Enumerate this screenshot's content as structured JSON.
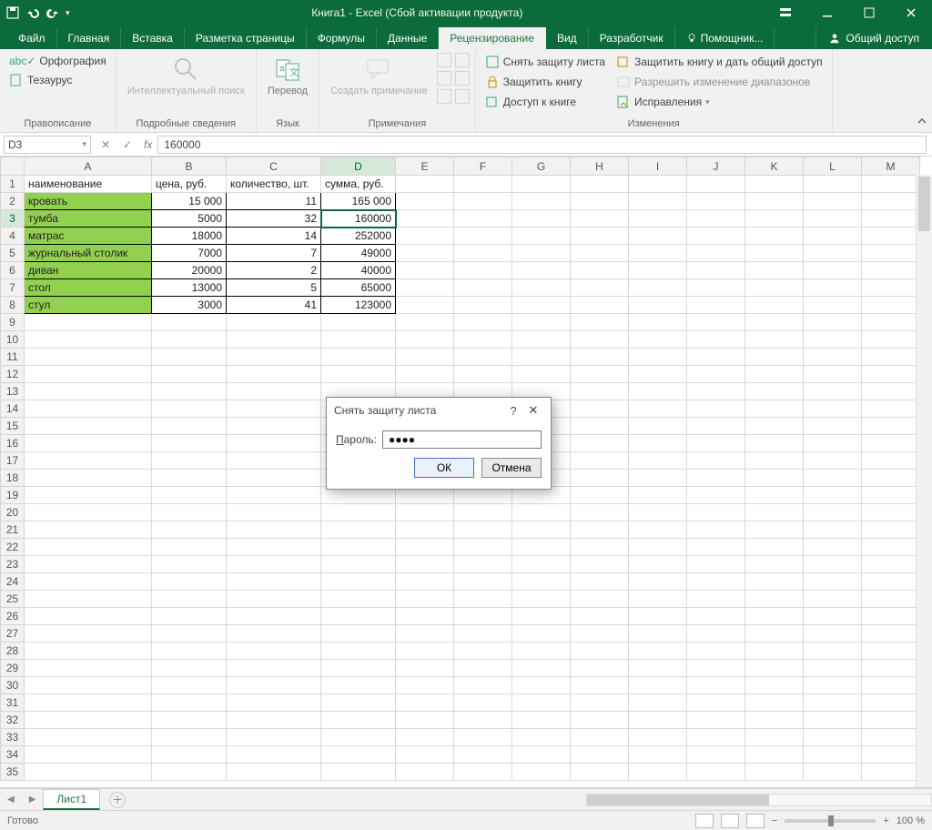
{
  "titlebar": {
    "title": "Книга1 - Excel (Сбой активации продукта)"
  },
  "tabs": {
    "file": "Файл",
    "home": "Главная",
    "insert": "Вставка",
    "layout": "Разметка страницы",
    "formulas": "Формулы",
    "data": "Данные",
    "review": "Рецензирование",
    "view": "Вид",
    "developer": "Разработчик",
    "help": "Помощник...",
    "share": "Общий доступ"
  },
  "ribbon": {
    "proof": {
      "spell": "Орфография",
      "thesaurus": "Тезаурус",
      "label": "Правописание"
    },
    "insights": {
      "smartlookup": "Интеллектуальный поиск",
      "label": "Подробные сведения"
    },
    "lang": {
      "translate": "Перевод",
      "label": "Язык"
    },
    "comments": {
      "new": "Создать примечание",
      "label": "Примечания"
    },
    "changes": {
      "unprotect_sheet": "Снять защиту листа",
      "protect_wb": "Защитить книгу",
      "share_wb": "Доступ к книге",
      "protect_share": "Защитить книгу и дать общий доступ",
      "allow_ranges": "Разрешить изменение диапазонов",
      "track": "Исправления",
      "label": "Изменения"
    }
  },
  "namebox": "D3",
  "formula_value": "160000",
  "columns": [
    "A",
    "B",
    "C",
    "D",
    "E",
    "F",
    "G",
    "H",
    "I",
    "J",
    "K",
    "L",
    "M"
  ],
  "col_widths": [
    "col-0",
    "col-1",
    "col-2",
    "col-3",
    "col-o",
    "col-o",
    "col-o",
    "col-o",
    "col-o",
    "col-o",
    "col-o",
    "col-o",
    "col-o"
  ],
  "headers": [
    "наименование",
    "цена, руб.",
    "количество, шт.",
    "сумма, руб."
  ],
  "rows": [
    {
      "name": "кровать",
      "price": "15 000",
      "qty": "11",
      "sum": "165 000"
    },
    {
      "name": "тумба",
      "price": "5000",
      "qty": "32",
      "sum": "160000"
    },
    {
      "name": "матрас",
      "price": "18000",
      "qty": "14",
      "sum": "252000"
    },
    {
      "name": "журнальный столик",
      "price": "7000",
      "qty": "7",
      "sum": "49000"
    },
    {
      "name": "диван",
      "price": "20000",
      "qty": "2",
      "sum": "40000"
    },
    {
      "name": "стол",
      "price": "13000",
      "qty": "5",
      "sum": "65000"
    },
    {
      "name": "стул",
      "price": "3000",
      "qty": "41",
      "sum": "123000"
    }
  ],
  "empty_rows": 27,
  "selected": {
    "row": 3,
    "col": "D"
  },
  "sheet_tab": "Лист1",
  "status": {
    "ready": "Готово",
    "zoom": "100 %"
  },
  "dialog": {
    "title": "Снять защиту листа",
    "password_label": "Пароль:",
    "password_underline": "П",
    "password_rest": "ароль:",
    "password_value": "●●●●",
    "ok": "ОК",
    "cancel": "Отмена"
  }
}
